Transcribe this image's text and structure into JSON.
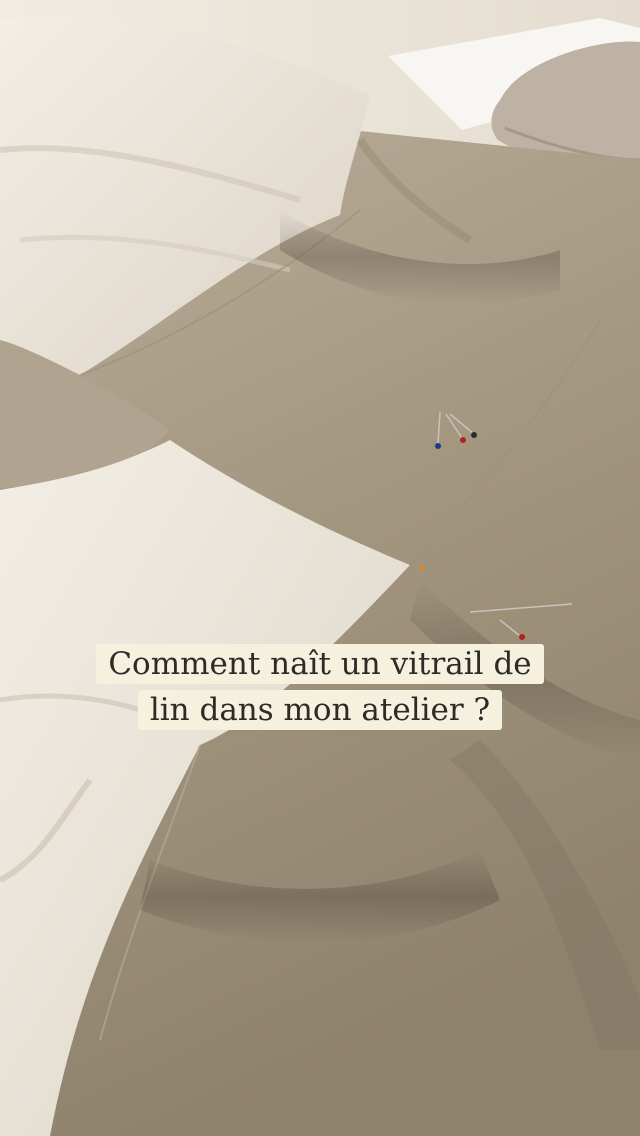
{
  "caption": {
    "line1": "Comment naît un vitrail de",
    "line2": "lin dans mon atelier ?"
  },
  "colors": {
    "caption_bg": "#f6f0df",
    "caption_text": "#2e2a25",
    "linen_white": "#ede6d8",
    "linen_natural": "#a89b87"
  }
}
